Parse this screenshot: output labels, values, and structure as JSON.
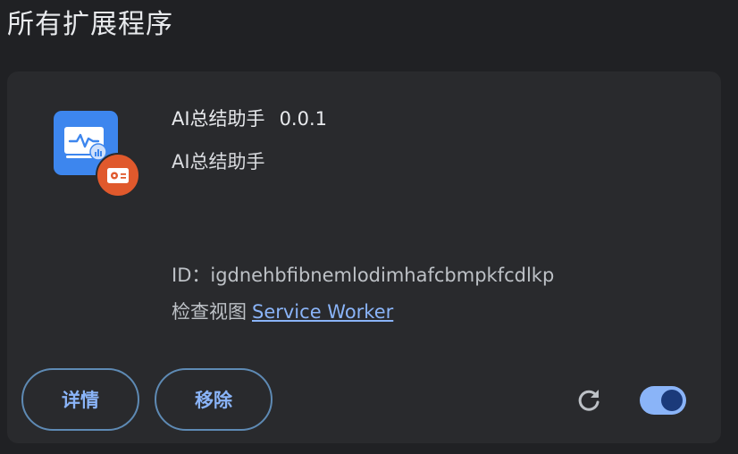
{
  "section": {
    "title": "所有扩展程序"
  },
  "extension": {
    "name": "AI总结助手",
    "version": "0.0.1",
    "description": "AI总结助手",
    "id_label": "ID：",
    "id_value": "igdnehbfibnemlodimhafcbmpkfcdlkp",
    "inspect_label": "检查视图",
    "inspect_link": "Service Worker",
    "icon": "monitor-chart-icon",
    "badge_icon": "screen-record-icon",
    "enabled": true
  },
  "actions": {
    "details_label": "详情",
    "remove_label": "移除",
    "reload_icon": "reload-icon",
    "toggle_state": "on"
  },
  "colors": {
    "background": "#202124",
    "card": "#292a2d",
    "accent": "#8ab4f8",
    "icon_blue": "#3d86ee",
    "badge_orange": "#e0592c"
  }
}
